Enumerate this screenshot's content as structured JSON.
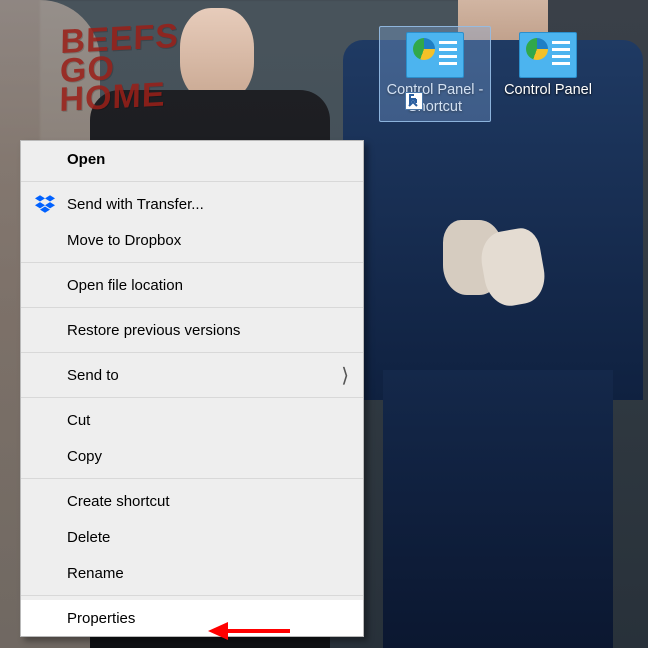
{
  "graffiti_text": "BEEFS\nGO\nHOME",
  "desktop_icons": [
    {
      "label": "Control Panel - Shortcut",
      "is_shortcut": true,
      "selected": true
    },
    {
      "label": "Control Panel",
      "is_shortcut": false,
      "selected": false
    }
  ],
  "context_menu": {
    "open": "Open",
    "send_transfer": "Send with Transfer...",
    "move_dropbox": "Move to Dropbox",
    "open_location": "Open file location",
    "restore_versions": "Restore previous versions",
    "send_to": "Send to",
    "cut": "Cut",
    "copy": "Copy",
    "create_shortcut": "Create shortcut",
    "delete": "Delete",
    "rename": "Rename",
    "properties": "Properties"
  },
  "icons": {
    "dropbox": "dropbox-icon"
  },
  "highlighted_item": "properties"
}
